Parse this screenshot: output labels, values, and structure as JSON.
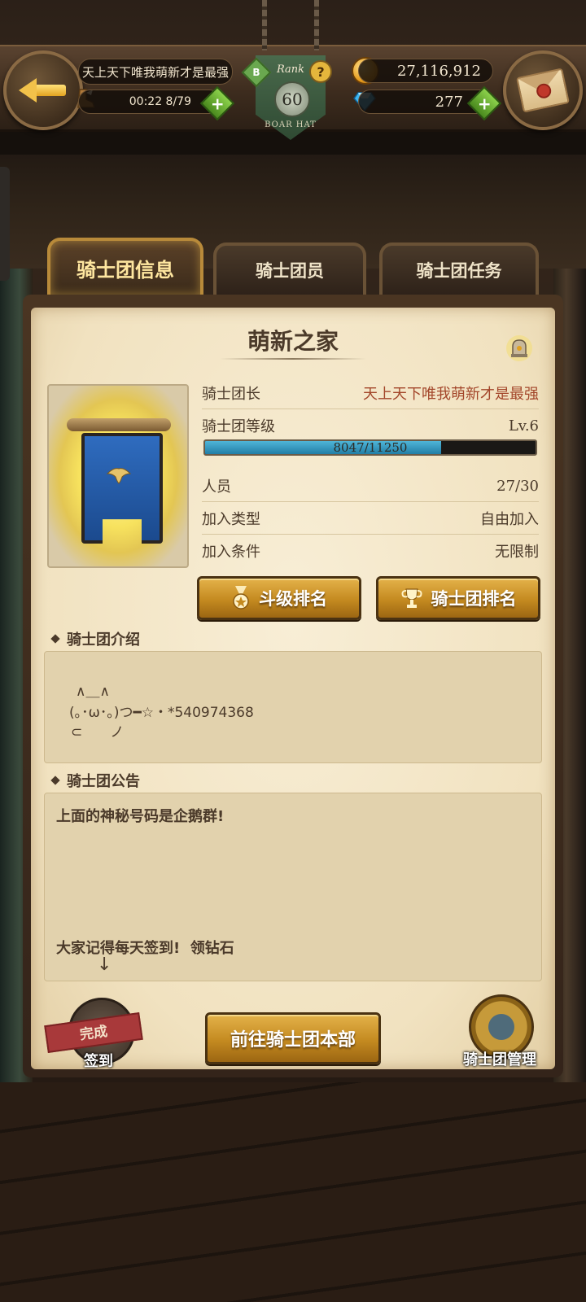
{
  "topbar": {
    "player_name": "天上天下唯我萌新才是最强",
    "stamina_text": "00:22 8/79",
    "gold": "27,116,912",
    "gems": "277",
    "rank": {
      "label": "Rank",
      "level": "60",
      "motto": "BOAR HAT",
      "badge": "B",
      "help": "?"
    }
  },
  "tabs": [
    {
      "label": "骑士团信息",
      "active": true
    },
    {
      "label": "骑士团员",
      "active": false
    },
    {
      "label": "骑士团任务",
      "active": false
    }
  ],
  "guild": {
    "name": "萌新之家",
    "leader_label": "骑士团长",
    "leader_value": "天上天下唯我萌新才是最强",
    "level_label": "骑士团等级",
    "level_value": "Lv.6",
    "exp_text": "8047/11250",
    "exp_current": 8047,
    "exp_max": 11250,
    "members_label": "人员",
    "members_value": "27/30",
    "join_type_label": "加入类型",
    "join_type_value": "自由加入",
    "join_cond_label": "加入条件",
    "join_cond_value": "无限制"
  },
  "buttons": {
    "duel_rank": "斗级排名",
    "guild_rank": "骑士团排名",
    "go_hq": "前往骑士团本部",
    "checkin": "签到",
    "checkin_status": "完成",
    "manage": "骑士团管理"
  },
  "intro": {
    "label": "骑士团介绍",
    "lines": [
      "∧＿∧",
      "(｡･ω･｡)つ━☆・*540974368",
      "⊂　　ノ"
    ]
  },
  "notice": {
    "label": "骑士团公告",
    "lines": [
      "上面的神秘号码是企鹅群!",
      "大家记得每天签到!  领钻石",
      "↓"
    ]
  },
  "colors": {
    "accent_gold": "#e4b24a",
    "leader_name": "#a3462a",
    "exp_fill": "#227ea6",
    "checkin_tag": "#a8393a"
  }
}
